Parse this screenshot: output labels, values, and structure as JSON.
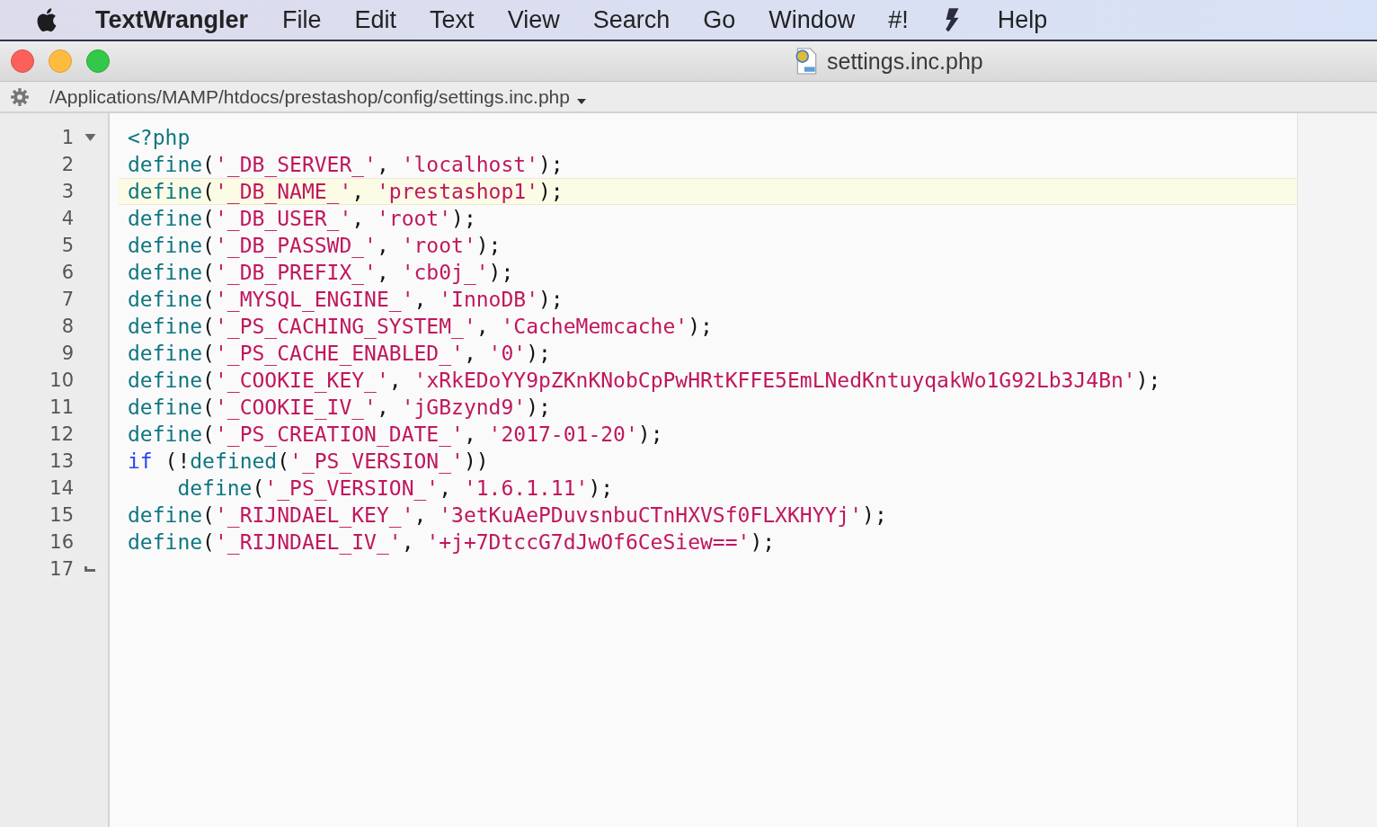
{
  "menu_bar": {
    "app_name": "TextWrangler",
    "items_before_script": [
      "File",
      "Edit",
      "Text",
      "View",
      "Search",
      "Go",
      "Window",
      "#!"
    ],
    "items_after_script": [
      "Help"
    ]
  },
  "window": {
    "title": "settings.inc.php"
  },
  "path_bar": {
    "path": "/Applications/MAMP/htdocs/prestashop/config/settings.inc.php"
  },
  "editor": {
    "lines": [
      {
        "number": "1",
        "current": false,
        "fold_start": true,
        "tokens": [
          {
            "kind": "function",
            "text": "<?php"
          }
        ]
      },
      {
        "number": "2",
        "current": false,
        "tokens": [
          {
            "kind": "function",
            "text": "define"
          },
          {
            "kind": "plain",
            "text": "("
          },
          {
            "kind": "string",
            "text": "'_DB_SERVER_'"
          },
          {
            "kind": "plain",
            "text": ", "
          },
          {
            "kind": "string",
            "text": "'localhost'"
          },
          {
            "kind": "plain",
            "text": ");"
          }
        ]
      },
      {
        "number": "3",
        "current": true,
        "tokens": [
          {
            "kind": "function",
            "text": "define"
          },
          {
            "kind": "plain",
            "text": "("
          },
          {
            "kind": "string",
            "text": "'_DB_NAME_'"
          },
          {
            "kind": "plain",
            "text": ", "
          },
          {
            "kind": "string",
            "text": "'prestashop1'"
          },
          {
            "kind": "plain",
            "text": ");"
          }
        ]
      },
      {
        "number": "4",
        "current": false,
        "tokens": [
          {
            "kind": "function",
            "text": "define"
          },
          {
            "kind": "plain",
            "text": "("
          },
          {
            "kind": "string",
            "text": "'_DB_USER_'"
          },
          {
            "kind": "plain",
            "text": ", "
          },
          {
            "kind": "string",
            "text": "'root'"
          },
          {
            "kind": "plain",
            "text": ");"
          }
        ]
      },
      {
        "number": "5",
        "current": false,
        "tokens": [
          {
            "kind": "function",
            "text": "define"
          },
          {
            "kind": "plain",
            "text": "("
          },
          {
            "kind": "string",
            "text": "'_DB_PASSWD_'"
          },
          {
            "kind": "plain",
            "text": ", "
          },
          {
            "kind": "string",
            "text": "'root'"
          },
          {
            "kind": "plain",
            "text": ");"
          }
        ]
      },
      {
        "number": "6",
        "current": false,
        "tokens": [
          {
            "kind": "function",
            "text": "define"
          },
          {
            "kind": "plain",
            "text": "("
          },
          {
            "kind": "string",
            "text": "'_DB_PREFIX_'"
          },
          {
            "kind": "plain",
            "text": ", "
          },
          {
            "kind": "string",
            "text": "'cb0j_'"
          },
          {
            "kind": "plain",
            "text": ");"
          }
        ]
      },
      {
        "number": "7",
        "current": false,
        "tokens": [
          {
            "kind": "function",
            "text": "define"
          },
          {
            "kind": "plain",
            "text": "("
          },
          {
            "kind": "string",
            "text": "'_MYSQL_ENGINE_'"
          },
          {
            "kind": "plain",
            "text": ", "
          },
          {
            "kind": "string",
            "text": "'InnoDB'"
          },
          {
            "kind": "plain",
            "text": ");"
          }
        ]
      },
      {
        "number": "8",
        "current": false,
        "tokens": [
          {
            "kind": "function",
            "text": "define"
          },
          {
            "kind": "plain",
            "text": "("
          },
          {
            "kind": "string",
            "text": "'_PS_CACHING_SYSTEM_'"
          },
          {
            "kind": "plain",
            "text": ", "
          },
          {
            "kind": "string",
            "text": "'CacheMemcache'"
          },
          {
            "kind": "plain",
            "text": ");"
          }
        ]
      },
      {
        "number": "9",
        "current": false,
        "tokens": [
          {
            "kind": "function",
            "text": "define"
          },
          {
            "kind": "plain",
            "text": "("
          },
          {
            "kind": "string",
            "text": "'_PS_CACHE_ENABLED_'"
          },
          {
            "kind": "plain",
            "text": ", "
          },
          {
            "kind": "string",
            "text": "'0'"
          },
          {
            "kind": "plain",
            "text": ");"
          }
        ]
      },
      {
        "number": "10",
        "current": false,
        "tokens": [
          {
            "kind": "function",
            "text": "define"
          },
          {
            "kind": "plain",
            "text": "("
          },
          {
            "kind": "string",
            "text": "'_COOKIE_KEY_'"
          },
          {
            "kind": "plain",
            "text": ", "
          },
          {
            "kind": "string",
            "text": "'xRkEDoYY9pZKnKNobCpPwHRtKFFE5EmLNedKntuyqakWo1G92Lb3J4Bn'"
          },
          {
            "kind": "plain",
            "text": ");"
          }
        ]
      },
      {
        "number": "11",
        "current": false,
        "tokens": [
          {
            "kind": "function",
            "text": "define"
          },
          {
            "kind": "plain",
            "text": "("
          },
          {
            "kind": "string",
            "text": "'_COOKIE_IV_'"
          },
          {
            "kind": "plain",
            "text": ", "
          },
          {
            "kind": "string",
            "text": "'jGBzynd9'"
          },
          {
            "kind": "plain",
            "text": ");"
          }
        ]
      },
      {
        "number": "12",
        "current": false,
        "tokens": [
          {
            "kind": "function",
            "text": "define"
          },
          {
            "kind": "plain",
            "text": "("
          },
          {
            "kind": "string",
            "text": "'_PS_CREATION_DATE_'"
          },
          {
            "kind": "plain",
            "text": ", "
          },
          {
            "kind": "string",
            "text": "'2017-01-20'"
          },
          {
            "kind": "plain",
            "text": ");"
          }
        ]
      },
      {
        "number": "13",
        "current": false,
        "tokens": [
          {
            "kind": "keyword",
            "text": "if"
          },
          {
            "kind": "plain",
            "text": " (!"
          },
          {
            "kind": "function",
            "text": "defined"
          },
          {
            "kind": "plain",
            "text": "("
          },
          {
            "kind": "string",
            "text": "'_PS_VERSION_'"
          },
          {
            "kind": "plain",
            "text": "))"
          }
        ]
      },
      {
        "number": "14",
        "current": false,
        "tokens": [
          {
            "kind": "function",
            "text": "    define"
          },
          {
            "kind": "plain",
            "text": "("
          },
          {
            "kind": "string",
            "text": "'_PS_VERSION_'"
          },
          {
            "kind": "plain",
            "text": ", "
          },
          {
            "kind": "string",
            "text": "'1.6.1.11'"
          },
          {
            "kind": "plain",
            "text": ");"
          }
        ]
      },
      {
        "number": "15",
        "current": false,
        "tokens": [
          {
            "kind": "function",
            "text": "define"
          },
          {
            "kind": "plain",
            "text": "("
          },
          {
            "kind": "string",
            "text": "'_RIJNDAEL_KEY_'"
          },
          {
            "kind": "plain",
            "text": ", "
          },
          {
            "kind": "string",
            "text": "'3etKuAePDuvsnbuCTnHXVSf0FLXKHYYj'"
          },
          {
            "kind": "plain",
            "text": ");"
          }
        ]
      },
      {
        "number": "16",
        "current": false,
        "tokens": [
          {
            "kind": "function",
            "text": "define"
          },
          {
            "kind": "plain",
            "text": "("
          },
          {
            "kind": "string",
            "text": "'_RIJNDAEL_IV_'"
          },
          {
            "kind": "plain",
            "text": ", "
          },
          {
            "kind": "string",
            "text": "'+j+7DtccG7dJwOf6CeSiew=='"
          },
          {
            "kind": "plain",
            "text": ");"
          }
        ]
      },
      {
        "number": "17",
        "current": false,
        "fold_end": true
      }
    ]
  }
}
